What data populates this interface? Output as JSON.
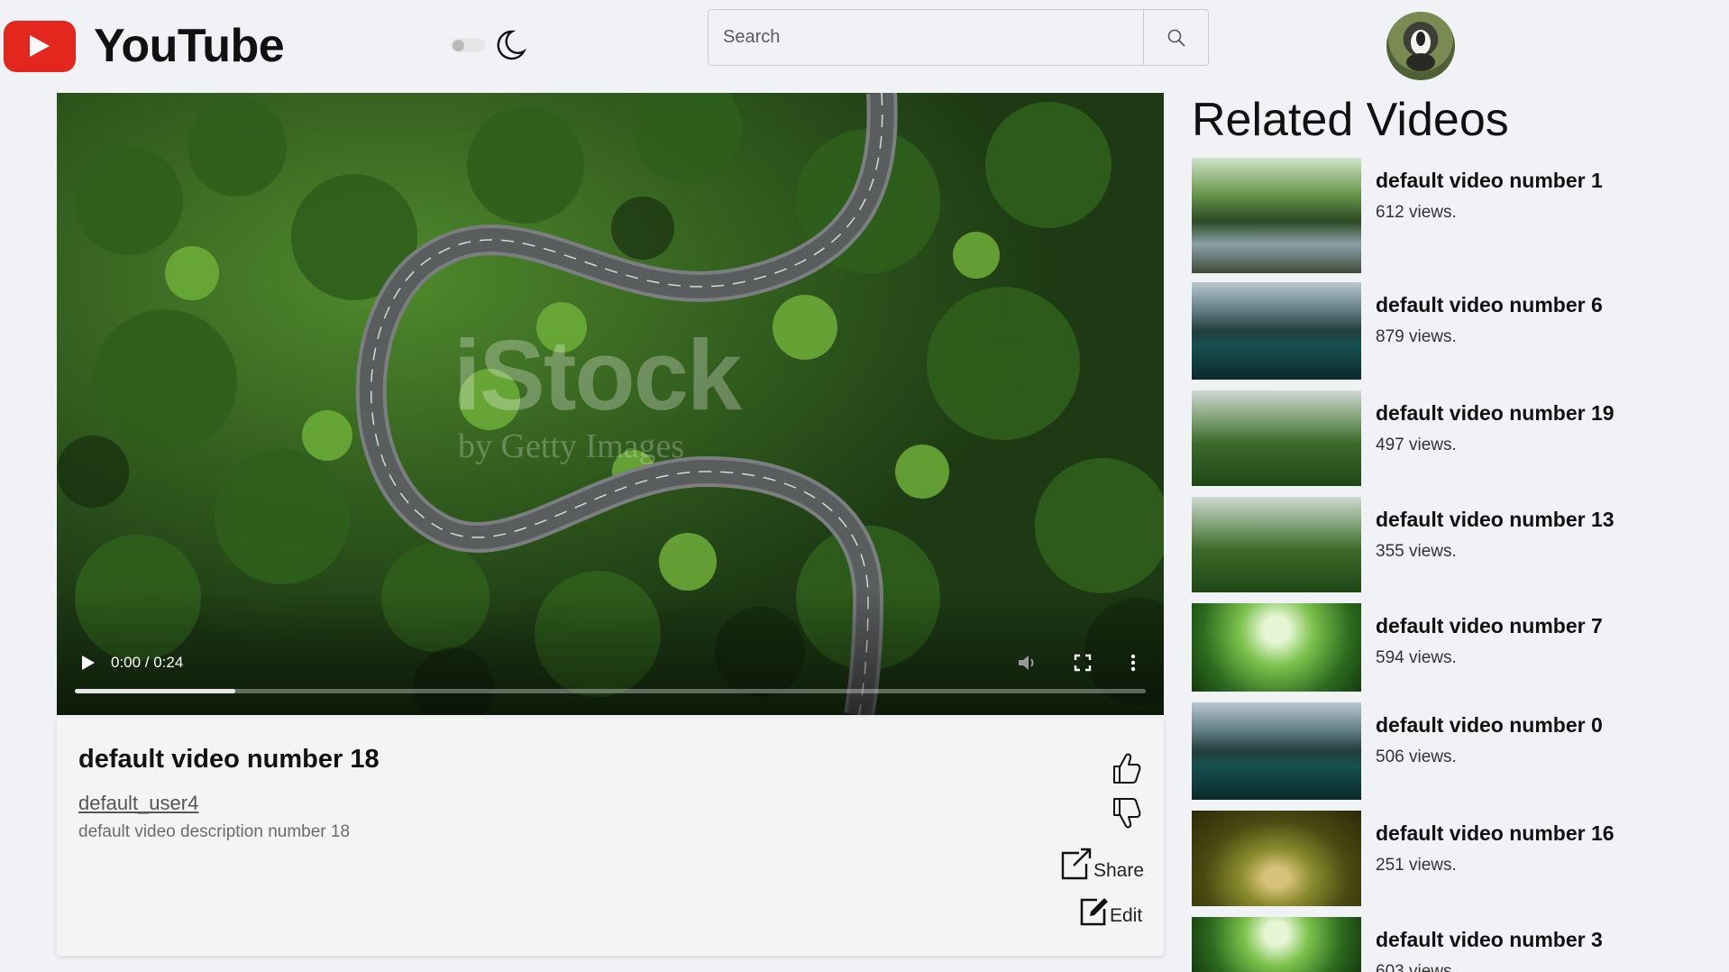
{
  "header": {
    "logo_text": "YouTube",
    "search_placeholder": "Search",
    "icons": [
      "youtube-play-icon",
      "toggle-switch",
      "moon-icon",
      "search-icon",
      "avatar"
    ]
  },
  "player": {
    "time": "0:00 / 0:24",
    "watermark_main": "iStock",
    "watermark_sub": "by Getty Images",
    "progress_fraction": 0.15
  },
  "video": {
    "title": "default video number 18",
    "channel": "default_user4",
    "description": "default video description number 18",
    "share_label": "Share",
    "edit_label": "Edit"
  },
  "related": {
    "heading": "Related Videos",
    "items": [
      {
        "title": "default video number 1",
        "views": "612 views.",
        "thumb": "forest-stream"
      },
      {
        "title": "default video number 6",
        "views": "879 views.",
        "thumb": "mountain-lake"
      },
      {
        "title": "default video number 19",
        "views": "497 views.",
        "thumb": "waterfall"
      },
      {
        "title": "default video number 13",
        "views": "355 views.",
        "thumb": "waterfall"
      },
      {
        "title": "default video number 7",
        "views": "594 views.",
        "thumb": "tall-trees"
      },
      {
        "title": "default video number 0",
        "views": "506 views.",
        "thumb": "mountain-lake"
      },
      {
        "title": "default video number 16",
        "views": "251 views.",
        "thumb": "tree-tunnel"
      },
      {
        "title": "default video number 3",
        "views": "603 views.",
        "thumb": "tall-trees"
      }
    ]
  },
  "colors": {
    "brand_red": "#e3271f",
    "background": "#f1f2f6",
    "card": "#f4f4f4"
  }
}
